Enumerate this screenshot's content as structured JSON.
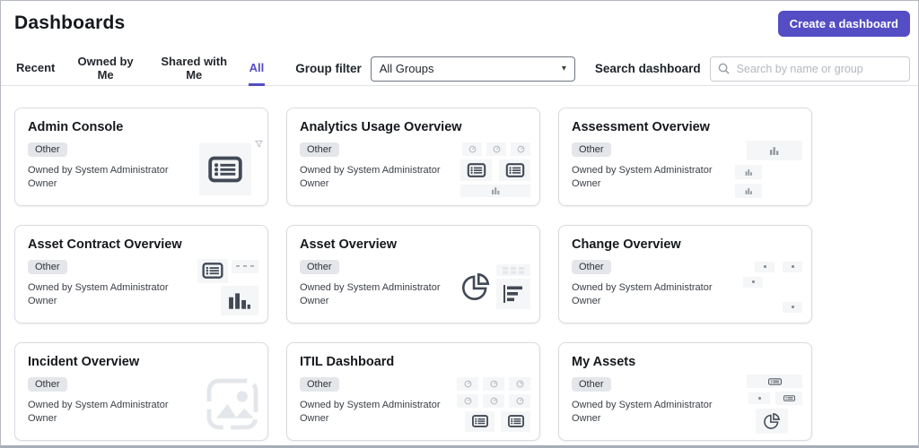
{
  "header": {
    "title": "Dashboards",
    "create_button_label": "Create a dashboard"
  },
  "tabs": [
    {
      "label": "Recent",
      "active": false
    },
    {
      "label": "Owned by Me",
      "active": false
    },
    {
      "label": "Shared with Me",
      "active": false
    },
    {
      "label": "All",
      "active": true
    }
  ],
  "toolbar": {
    "group_filter_label": "Group filter",
    "group_filter_value": "All Groups",
    "search_label": "Search dashboard",
    "search_placeholder": "Search by name or group"
  },
  "cards": [
    {
      "title": "Admin Console",
      "badge": "Other",
      "owned_by": "Owned by System Administrator",
      "role": "Owner",
      "thumb": "admin-list"
    },
    {
      "title": "Analytics Usage Overview",
      "badge": "Other",
      "owned_by": "Owned by System Administrator",
      "role": "Owner",
      "thumb": "gauges-lists-bar"
    },
    {
      "title": "Assessment Overview",
      "badge": "Other",
      "owned_by": "Owned by System Administrator",
      "role": "Owner",
      "thumb": "bar-rows"
    },
    {
      "title": "Asset Contract Overview",
      "badge": "Other",
      "owned_by": "Owned by System Administrator",
      "role": "Owner",
      "thumb": "list-dashes-vbars"
    },
    {
      "title": "Asset Overview",
      "badge": "Other",
      "owned_by": "Owned by System Administrator",
      "role": "Owner",
      "thumb": "pie-hbars"
    },
    {
      "title": "Change Overview",
      "badge": "Other",
      "owned_by": "Owned by System Administrator",
      "role": "Owner",
      "thumb": "scatter-dots"
    },
    {
      "title": "Incident Overview",
      "badge": "Other",
      "owned_by": "Owned by System Administrator",
      "role": "Owner",
      "thumb": "image-placeholder"
    },
    {
      "title": "ITIL Dashboard",
      "badge": "Other",
      "owned_by": "Owned by System Administrator",
      "role": "Owner",
      "thumb": "gauges-grid-lists"
    },
    {
      "title": "My Assets",
      "badge": "Other",
      "owned_by": "Owned by System Administrator",
      "role": "Owner",
      "thumb": "list-dot-pie"
    }
  ],
  "colors": {
    "accent": "#544dc4",
    "badge_bg": "#e4e6e9",
    "icon_slate": "#414956",
    "icon_light": "#9aa1a9",
    "icon_faint": "#e3e6ea",
    "thumb_panel": "#f5f6f7",
    "card_border": "#d8dbdf",
    "divider": "#e1e3e6"
  }
}
